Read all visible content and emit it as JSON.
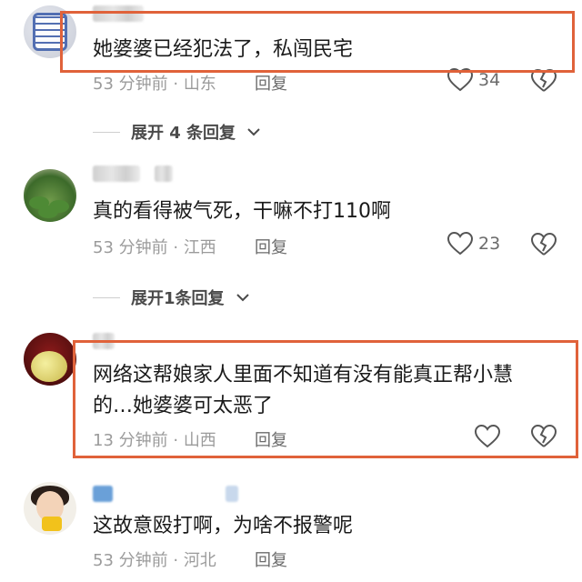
{
  "comments": [
    {
      "text": "她婆婆已经犯法了，私闯民宅",
      "time": "53 分钟前",
      "region": "山东",
      "reply_label": "回复",
      "likes": "34",
      "expand_label": "展开 4 条回复"
    },
    {
      "text": "真的看得被气死，干嘛不打110啊",
      "time": "53 分钟前",
      "region": "江西",
      "reply_label": "回复",
      "likes": "23",
      "expand_label": "展开1条回复"
    },
    {
      "text": "网络这帮娘家人里面不知道有没有能真正帮小慧的…她婆婆可太恶了",
      "time": "13 分钟前",
      "region": "山西",
      "reply_label": "回复"
    },
    {
      "text": "这故意殴打啊，为啥不报警呢",
      "time": "53 分钟前",
      "region": "河北",
      "reply_label": "回复"
    }
  ],
  "colors": {
    "highlight": "#e0623a",
    "meta": "#9b9b9b"
  }
}
